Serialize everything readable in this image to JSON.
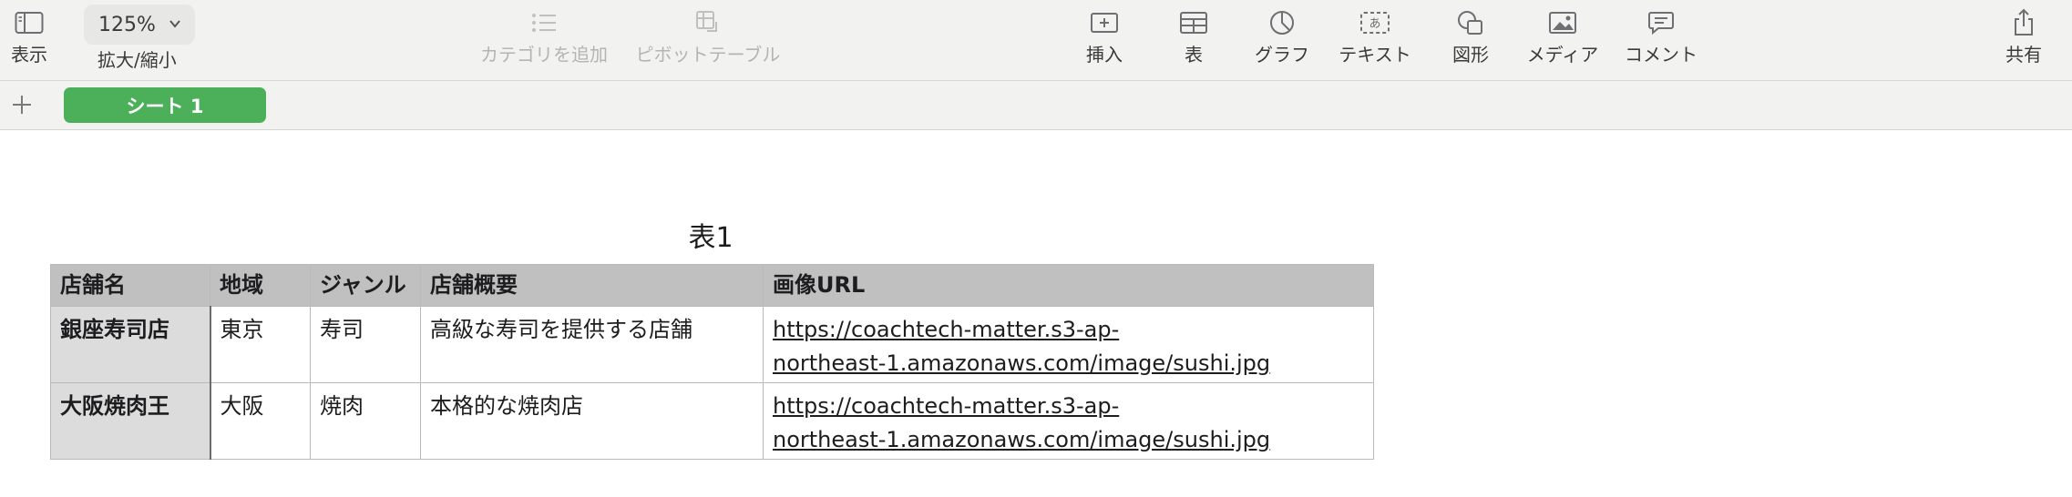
{
  "toolbar": {
    "view_label": "表示",
    "zoom_value": "125%",
    "zoom_label": "拡大/縮小",
    "add_category_label": "カテゴリを追加",
    "pivot_table_label": "ピボットテーブル",
    "insert_label": "挿入",
    "table_label": "表",
    "chart_label": "グラフ",
    "text_label": "テキスト",
    "shape_label": "図形",
    "media_label": "メディア",
    "comment_label": "コメント",
    "share_label": "共有"
  },
  "sheets": {
    "tabs": [
      {
        "label": "シート 1",
        "active": true
      }
    ],
    "accent": "#4caf59"
  },
  "table": {
    "title": "表1",
    "headers": [
      "店舗名",
      "地域",
      "ジャンル",
      "店舗概要",
      "画像URL"
    ],
    "rows": [
      {
        "name": "銀座寿司店",
        "region": "東京",
        "genre": "寿司",
        "summary": "高級な寿司を提供する店舗",
        "url_line1": "https://coachtech-matter.s3-ap-",
        "url_line2": "northeast-1.amazonaws.com/image/sushi.jpg"
      },
      {
        "name": "大阪焼肉王",
        "region": "大阪",
        "genre": "焼肉",
        "summary": "本格的な焼肉店",
        "url_line1": "https://coachtech-matter.s3-ap-",
        "url_line2": "northeast-1.amazonaws.com/image/sushi.jpg"
      }
    ]
  }
}
